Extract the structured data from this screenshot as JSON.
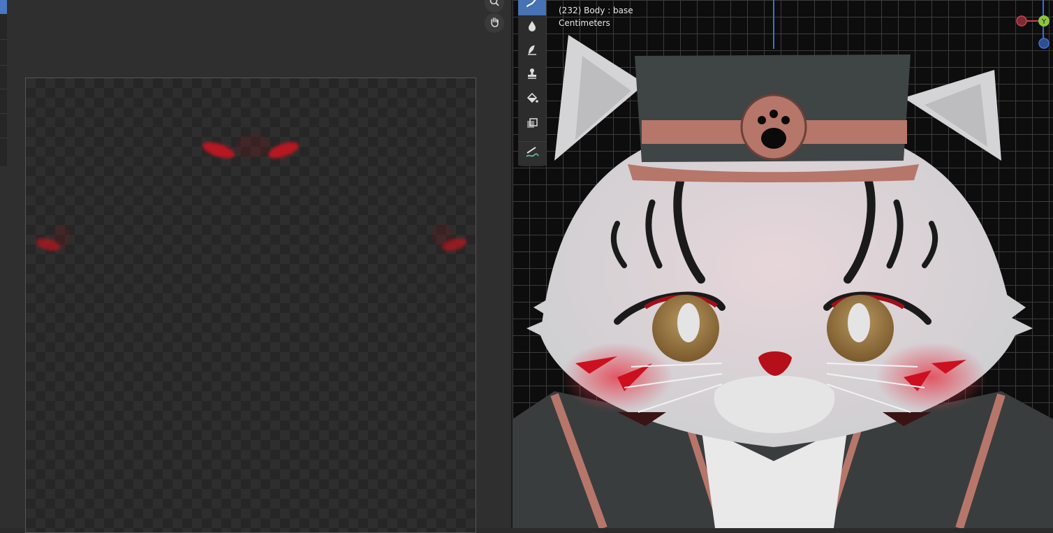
{
  "viewport": {
    "info_line1": "(232) Body : base",
    "info_line2": "Centimeters"
  },
  "gizmo": {
    "y_label": "Y"
  },
  "toolbar": {
    "tools": [
      "draw-icon",
      "blur-icon",
      "smear-icon",
      "clone-icon",
      "fill-icon",
      "mask-icon",
      "annotate-icon"
    ],
    "active_tool": "draw-icon"
  },
  "image_editor": {
    "nav_tools": [
      "zoom-icon",
      "pan-hand-icon"
    ]
  },
  "colors": {
    "active_blue": "#4772b3",
    "x_axis": "#c8424f",
    "y_axis": "#8cc63f",
    "z_axis": "#3f6fd1",
    "paint_red": "#d0141e"
  }
}
